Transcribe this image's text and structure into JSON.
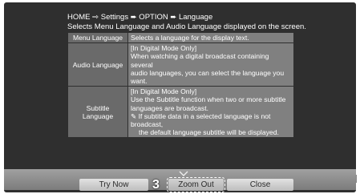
{
  "breadcrumb": "HOME ⇨ Settings ➨ OPTION ➨ Language",
  "subtitle": "Selects Menu Language and Audio Language displayed on the screen.",
  "rows": [
    {
      "label": "Menu Language",
      "lines": [
        "Selects a language for the display text."
      ]
    },
    {
      "label": "Audio Language",
      "lines": [
        "[In Digital Mode Only]",
        "When watching a digital broadcast containing several",
        "audio languages, you can select the language you want."
      ]
    },
    {
      "label": "Subtitle Language",
      "lines": [
        "[In Digital Mode Only]",
        "Use the Subtitle function when two or more subtitle",
        "languages are broadcast."
      ],
      "note": [
        "✎ If subtitle data in a selected language is not broadcast,",
        "the default language subtitle will be displayed."
      ]
    }
  ],
  "buttons": {
    "try_now": "Try Now",
    "zoom_out": "Zoom Out",
    "close": "Close"
  },
  "step_number": "3",
  "icons": {
    "scroll_indicator": "chevron-down-icon"
  },
  "colors": {
    "screen_bg": "#2f2f2f",
    "label_cell": "#6a6a6a",
    "desc_cell": "#808080",
    "button": "#cfcfcf"
  }
}
